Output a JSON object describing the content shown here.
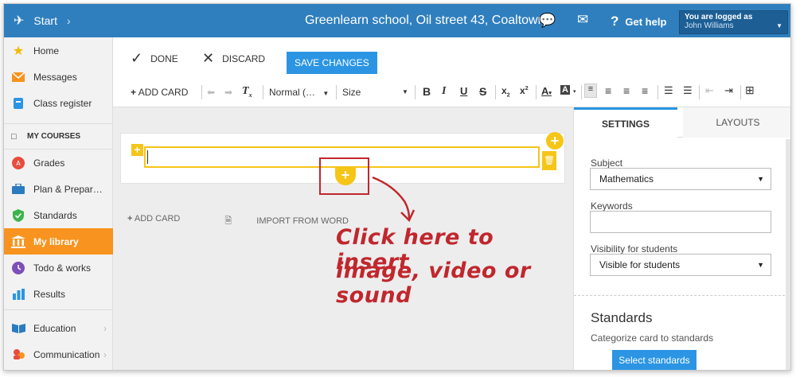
{
  "topbar": {
    "start_label": "Start",
    "school": "Greenlearn school, Oil street 43, Coaltown",
    "help_label": "Get help",
    "user_line1": "You are logged as",
    "user_line2": "John Williams"
  },
  "sidebar": {
    "items": [
      {
        "label": "Home",
        "icon": "star-icon"
      },
      {
        "label": "Messages",
        "icon": "envelope-icon"
      },
      {
        "label": "Class register",
        "icon": "register-icon"
      },
      {
        "label": "Grades",
        "icon": "grades-icon"
      },
      {
        "label": "Plan & Prepar…",
        "icon": "briefcase-icon"
      },
      {
        "label": "Standards",
        "icon": "shield-check-icon"
      },
      {
        "label": "My library",
        "icon": "library-icon"
      },
      {
        "label": "Todo & works",
        "icon": "clock-icon"
      },
      {
        "label": "Results",
        "icon": "bar-chart-icon"
      },
      {
        "label": "Education",
        "icon": "book-icon"
      },
      {
        "label": "Communication",
        "icon": "people-icon"
      }
    ],
    "heading": "MY COURSES"
  },
  "actions": {
    "done": "DONE",
    "discard": "DISCARD",
    "save": "SAVE CHANGES"
  },
  "format": {
    "add_card": "ADD CARD",
    "style": "Normal (…",
    "size": "Size"
  },
  "content": {
    "add_card": "ADD CARD",
    "import": "IMPORT FROM WORD",
    "annotation_line1": "Click here to insert",
    "annotation_line2": "image, video or sound"
  },
  "panel": {
    "tab_settings": "SETTINGS",
    "tab_layouts": "LAYOUTS",
    "subject_label": "Subject",
    "subject_value": "Mathematics",
    "keywords_label": "Keywords",
    "keywords_value": "",
    "visibility_label": "Visibility for students",
    "visibility_value": "Visible for students",
    "standards_title": "Standards",
    "standards_sub": "Categorize card to standards",
    "standards_button": "Select standards"
  },
  "colors": {
    "brand_blue": "#2f7fbe",
    "accent_orange": "#f7931e",
    "card_yellow": "#f5c518",
    "annotation_red": "#c0272d",
    "button_blue": "#2b95e3"
  }
}
